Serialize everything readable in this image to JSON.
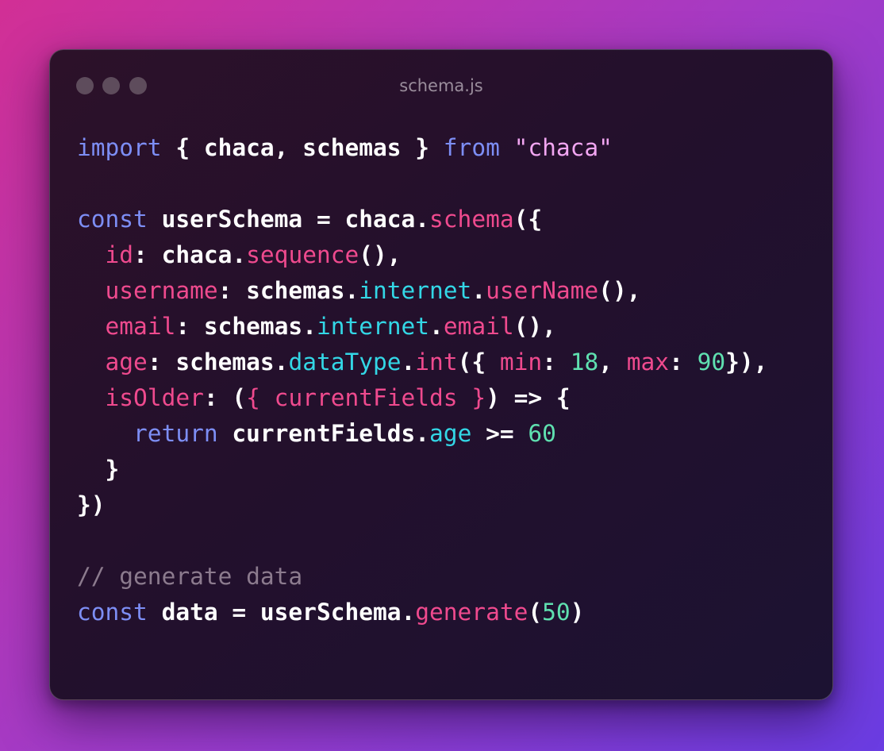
{
  "window": {
    "title": "schema.js"
  },
  "code": {
    "lines": [
      [
        {
          "t": "import",
          "c": "kw"
        },
        {
          "t": " { chaca, schemas } ",
          "c": "pl"
        },
        {
          "t": "from",
          "c": "kw"
        },
        {
          "t": " ",
          "c": "pl"
        },
        {
          "t": "\"chaca\"",
          "c": "str"
        }
      ],
      [],
      [
        {
          "t": "const",
          "c": "kw"
        },
        {
          "t": " userSchema = chaca.",
          "c": "pl"
        },
        {
          "t": "schema",
          "c": "fn"
        },
        {
          "t": "({",
          "c": "pl"
        }
      ],
      [
        {
          "t": "  ",
          "c": "pl"
        },
        {
          "t": "id",
          "c": "prop"
        },
        {
          "t": ": chaca.",
          "c": "pl"
        },
        {
          "t": "sequence",
          "c": "fn"
        },
        {
          "t": "(),",
          "c": "pl"
        }
      ],
      [
        {
          "t": "  ",
          "c": "pl"
        },
        {
          "t": "username",
          "c": "prop"
        },
        {
          "t": ": schemas.",
          "c": "pl"
        },
        {
          "t": "internet",
          "c": "mem"
        },
        {
          "t": ".",
          "c": "pl"
        },
        {
          "t": "userName",
          "c": "fn"
        },
        {
          "t": "(),",
          "c": "pl"
        }
      ],
      [
        {
          "t": "  ",
          "c": "pl"
        },
        {
          "t": "email",
          "c": "prop"
        },
        {
          "t": ": schemas.",
          "c": "pl"
        },
        {
          "t": "internet",
          "c": "mem"
        },
        {
          "t": ".",
          "c": "pl"
        },
        {
          "t": "email",
          "c": "fn"
        },
        {
          "t": "(),",
          "c": "pl"
        }
      ],
      [
        {
          "t": "  ",
          "c": "pl"
        },
        {
          "t": "age",
          "c": "prop"
        },
        {
          "t": ": schemas.",
          "c": "pl"
        },
        {
          "t": "dataType",
          "c": "mem"
        },
        {
          "t": ".",
          "c": "pl"
        },
        {
          "t": "int",
          "c": "fn"
        },
        {
          "t": "({ ",
          "c": "pl"
        },
        {
          "t": "min",
          "c": "prop"
        },
        {
          "t": ": ",
          "c": "pl"
        },
        {
          "t": "18",
          "c": "num"
        },
        {
          "t": ", ",
          "c": "pl"
        },
        {
          "t": "max",
          "c": "prop"
        },
        {
          "t": ": ",
          "c": "pl"
        },
        {
          "t": "90",
          "c": "num"
        },
        {
          "t": "}),",
          "c": "pl"
        }
      ],
      [
        {
          "t": "  ",
          "c": "pl"
        },
        {
          "t": "isOlder",
          "c": "prop"
        },
        {
          "t": ": (",
          "c": "pl"
        },
        {
          "t": "{ currentFields }",
          "c": "prop"
        },
        {
          "t": ") => {",
          "c": "pl"
        }
      ],
      [
        {
          "t": "    ",
          "c": "pl"
        },
        {
          "t": "return",
          "c": "kw"
        },
        {
          "t": " currentFields.",
          "c": "pl"
        },
        {
          "t": "age",
          "c": "mem"
        },
        {
          "t": " >= ",
          "c": "pl"
        },
        {
          "t": "60",
          "c": "num"
        }
      ],
      [
        {
          "t": "  }",
          "c": "pl"
        }
      ],
      [
        {
          "t": "})",
          "c": "pl"
        }
      ],
      [],
      [
        {
          "t": "// generate data",
          "c": "cm"
        }
      ],
      [
        {
          "t": "const",
          "c": "kw"
        },
        {
          "t": " data = userSchema.",
          "c": "pl"
        },
        {
          "t": "generate",
          "c": "fn"
        },
        {
          "t": "(",
          "c": "pl"
        },
        {
          "t": "50",
          "c": "num"
        },
        {
          "t": ")",
          "c": "pl"
        }
      ]
    ]
  },
  "colors": {
    "keyword": "#7d8ef5",
    "string": "#f2a6f2",
    "function": "#ef4a8e",
    "member": "#33d7e6",
    "number": "#5fe0b0",
    "comment": "#8c7b8e",
    "plain": "#ffffff"
  }
}
